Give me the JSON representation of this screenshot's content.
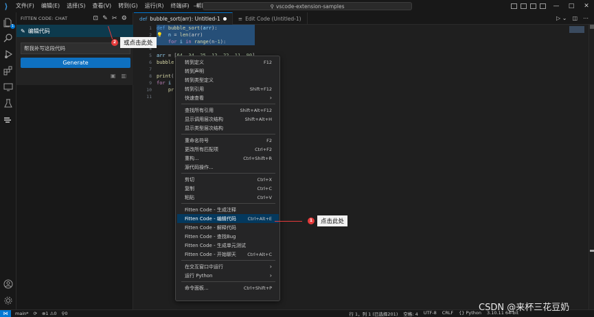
{
  "titlebar": {
    "menu": [
      "文件(F)",
      "编辑(E)",
      "选择(S)",
      "查看(V)",
      "转到(G)",
      "运行(R)",
      "终端(T)",
      "帮助(H)"
    ],
    "search_text": "vscode-extension-samples",
    "window_controls": [
      "—",
      "□",
      "✕"
    ]
  },
  "activity": {
    "explorer_badge": "1",
    "icons": [
      "files-icon",
      "search-icon",
      "run-debug-icon",
      "extensions-icon",
      "remote-icon",
      "testing-icon",
      "fitten-code-icon",
      "account-icon",
      "settings-gear-icon"
    ]
  },
  "sidebar": {
    "title": "FITTEN CODE: CHAT",
    "panel_title": "编辑代码",
    "input_placeholder": "帮我补写这段代码",
    "generate_label": "Generate"
  },
  "tabs": [
    {
      "lang": "def",
      "label": "bubble_sort(arr): Untitled-1",
      "dirty": true,
      "active": true
    },
    {
      "lang": "≡",
      "label": "Edit Code (Untitled-1)",
      "dirty": false,
      "active": false
    }
  ],
  "editor": {
    "line_numbers": [
      "1",
      "2",
      "3",
      "4",
      "5",
      "6",
      "7",
      "8",
      "9",
      "10",
      "11"
    ],
    "lines": [
      {
        "parts": [
          {
            "t": "def ",
            "c": "kw"
          },
          {
            "t": "bubble_sort",
            "c": "fn"
          },
          {
            "t": "(",
            "c": "pl"
          },
          {
            "t": "arr",
            "c": "var"
          },
          {
            "t": "):",
            "c": "pl"
          }
        ]
      },
      {
        "parts": [
          {
            "t": "    n ",
            "c": "var"
          },
          {
            "t": "= ",
            "c": "pl"
          },
          {
            "t": "len",
            "c": "fn"
          },
          {
            "t": "(arr)",
            "c": "pl"
          }
        ]
      },
      {
        "parts": [
          {
            "t": "    for ",
            "c": "kw2"
          },
          {
            "t": "i ",
            "c": "var"
          },
          {
            "t": "in ",
            "c": "kw2"
          },
          {
            "t": "range",
            "c": "fn"
          },
          {
            "t": "(n-",
            "c": "pl"
          },
          {
            "t": "1",
            "c": "num"
          },
          {
            "t": "):",
            "c": "pl"
          }
        ]
      },
      {
        "parts": [
          {
            "t": "",
            "c": "pl"
          }
        ]
      },
      {
        "parts": [
          {
            "t": "arr ",
            "c": "var"
          },
          {
            "t": "= [",
            "c": "pl"
          },
          {
            "t": "64, 34, 25, 12, 22, 11, 90",
            "c": "num"
          },
          {
            "t": "]",
            "c": "pl"
          }
        ]
      },
      {
        "parts": [
          {
            "t": "bubble",
            "c": "fn"
          }
        ]
      },
      {
        "parts": [
          {
            "t": "",
            "c": "pl"
          }
        ]
      },
      {
        "parts": [
          {
            "t": "print",
            "c": "fn"
          },
          {
            "t": "(",
            "c": "pl"
          }
        ]
      },
      {
        "parts": [
          {
            "t": "for ",
            "c": "kw2"
          },
          {
            "t": "i",
            "c": "var"
          }
        ]
      },
      {
        "parts": [
          {
            "t": "    pr",
            "c": "fn"
          }
        ]
      },
      {
        "parts": [
          {
            "t": "",
            "c": "pl"
          }
        ]
      }
    ]
  },
  "context_menu": {
    "items": [
      {
        "label": "转到定义",
        "key": "F12"
      },
      {
        "label": "转到声明",
        "key": ""
      },
      {
        "label": "转到类型定义",
        "key": ""
      },
      {
        "label": "转到引用",
        "key": "Shift+F12"
      },
      {
        "label": "快速查看",
        "key": "",
        "submenu": true
      },
      {
        "label": "查找所有引用",
        "key": "Shift+Alt+F12"
      },
      {
        "label": "显示调用层次结构",
        "key": "Shift+Alt+H"
      },
      {
        "label": "显示类型层次结构",
        "key": ""
      },
      {
        "label": "重命名符号",
        "key": "F2"
      },
      {
        "label": "更改所有匹配项",
        "key": "Ctrl+F2"
      },
      {
        "label": "重构...",
        "key": "Ctrl+Shift+R"
      },
      {
        "label": "源代码操作...",
        "key": ""
      },
      {
        "label": "剪切",
        "key": "Ctrl+X"
      },
      {
        "label": "复制",
        "key": "Ctrl+C"
      },
      {
        "label": "粘贴",
        "key": "Ctrl+V"
      },
      {
        "label": "Fitten Code - 生成注释",
        "key": ""
      },
      {
        "label": "Fitten Code - 编辑代码",
        "key": "Ctrl+Alt+E",
        "highlighted": true
      },
      {
        "label": "Fitten Code - 解释代码",
        "key": ""
      },
      {
        "label": "Fitten Code - 查找Bug",
        "key": ""
      },
      {
        "label": "Fitten Code - 生成单元测试",
        "key": ""
      },
      {
        "label": "Fitten Code - 开始聊天",
        "key": "Ctrl+Alt+C"
      },
      {
        "label": "在交互窗口中运行",
        "key": "",
        "submenu": true
      },
      {
        "label": "运行 Python",
        "key": "",
        "submenu": true
      },
      {
        "label": "命令面板...",
        "key": "Ctrl+Shift+P"
      }
    ]
  },
  "annotations": {
    "step1_number": "1",
    "step1_label": "点击此处",
    "step2_number": "2",
    "step2_label": "或点击此处"
  },
  "statusbar": {
    "remote": "⋈",
    "branch": "main*",
    "sync": "⟳",
    "problems": "⊗1 ⚠0",
    "ports": "⚲0",
    "position": "行 1，列 1 (已选择201)",
    "spaces": "空格: 4",
    "encoding": "UTF-8",
    "eol": "CRLF",
    "language": "{} Python",
    "interpreter": "3.10.11 64-bit"
  },
  "watermark": "CSDN @来杯三花豆奶"
}
